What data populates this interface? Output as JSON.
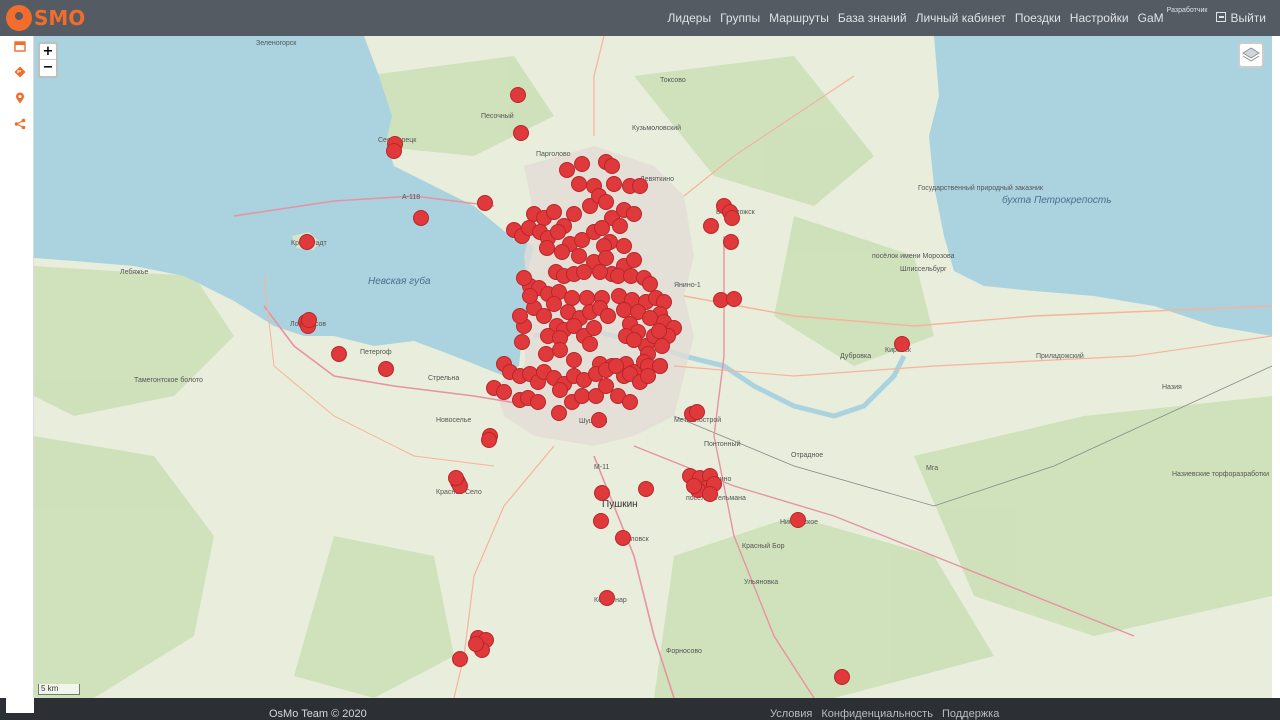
{
  "app": {
    "logo_text": "SMO"
  },
  "nav": {
    "items": [
      {
        "label": "Лидеры"
      },
      {
        "label": "Группы"
      },
      {
        "label": "Маршруты"
      },
      {
        "label": "База знаний"
      },
      {
        "label": "Личный кабинет"
      },
      {
        "label": "Поездки"
      },
      {
        "label": "Настройки"
      }
    ],
    "user": {
      "label": "GaM",
      "badge": "Разработчик"
    },
    "logout": "Выйти"
  },
  "sidebar": {
    "icons": [
      "calendar-icon",
      "route-icon",
      "pin-icon",
      "share-icon"
    ]
  },
  "map": {
    "zoom_in": "+",
    "zoom_out": "−",
    "scale_label": "5 km",
    "marker_color": "#e0393b",
    "water_color": "#aad3df",
    "labels": [
      {
        "text": "Зеленогорск",
        "cls": ""
      },
      {
        "text": "Сестрорецк",
        "cls": ""
      },
      {
        "text": "Песочный",
        "cls": ""
      },
      {
        "text": "Парголово",
        "cls": ""
      },
      {
        "text": "Кузьмоловский",
        "cls": ""
      },
      {
        "text": "Токсово",
        "cls": ""
      },
      {
        "text": "Девяткино",
        "cls": ""
      },
      {
        "text": "Кронштадт",
        "cls": ""
      },
      {
        "text": "Лебяжье",
        "cls": ""
      },
      {
        "text": "Невская губа",
        "cls": "big"
      },
      {
        "text": "Ломоносов",
        "cls": ""
      },
      {
        "text": "Петергоф",
        "cls": ""
      },
      {
        "text": "Стрельна",
        "cls": ""
      },
      {
        "text": "Новоселье",
        "cls": ""
      },
      {
        "text": "Красное Село",
        "cls": ""
      },
      {
        "text": "Пушкин",
        "cls": "city"
      },
      {
        "text": "Павловск",
        "cls": ""
      },
      {
        "text": "Коммунар",
        "cls": ""
      },
      {
        "text": "Форносово",
        "cls": ""
      },
      {
        "text": "Шушары",
        "cls": ""
      },
      {
        "text": "Металлострой",
        "cls": ""
      },
      {
        "text": "Понтонный",
        "cls": ""
      },
      {
        "text": "Отрадное",
        "cls": ""
      },
      {
        "text": "Колпино",
        "cls": ""
      },
      {
        "text": "посёлок Тельмана",
        "cls": ""
      },
      {
        "text": "Никольское",
        "cls": ""
      },
      {
        "text": "Красный Бор",
        "cls": ""
      },
      {
        "text": "Ульяновка",
        "cls": ""
      },
      {
        "text": "Янино-1",
        "cls": ""
      },
      {
        "text": "Всеволожск",
        "cls": ""
      },
      {
        "text": "посёлок имени Морозова",
        "cls": ""
      },
      {
        "text": "Шлиссельбург",
        "cls": ""
      },
      {
        "text": "Кировск",
        "cls": ""
      },
      {
        "text": "Дубровка",
        "cls": ""
      },
      {
        "text": "Приладожский",
        "cls": ""
      },
      {
        "text": "Назия",
        "cls": ""
      },
      {
        "text": "Мга",
        "cls": ""
      },
      {
        "text": "бухта Петрокрепость",
        "cls": "big"
      },
      {
        "text": "Назиевские торфоразработки",
        "cls": ""
      },
      {
        "text": "Государственный природный заказник",
        "cls": ""
      },
      {
        "text": "Тамегонтское болото",
        "cls": ""
      },
      {
        "text": "А-118",
        "cls": ""
      },
      {
        "text": "М-11",
        "cls": ""
      }
    ]
  },
  "footer": {
    "copyright": "OsMo Team © 2020",
    "links": [
      {
        "label": "Условия"
      },
      {
        "label": "Конфиденциальность"
      },
      {
        "label": "Поддержка"
      }
    ]
  }
}
